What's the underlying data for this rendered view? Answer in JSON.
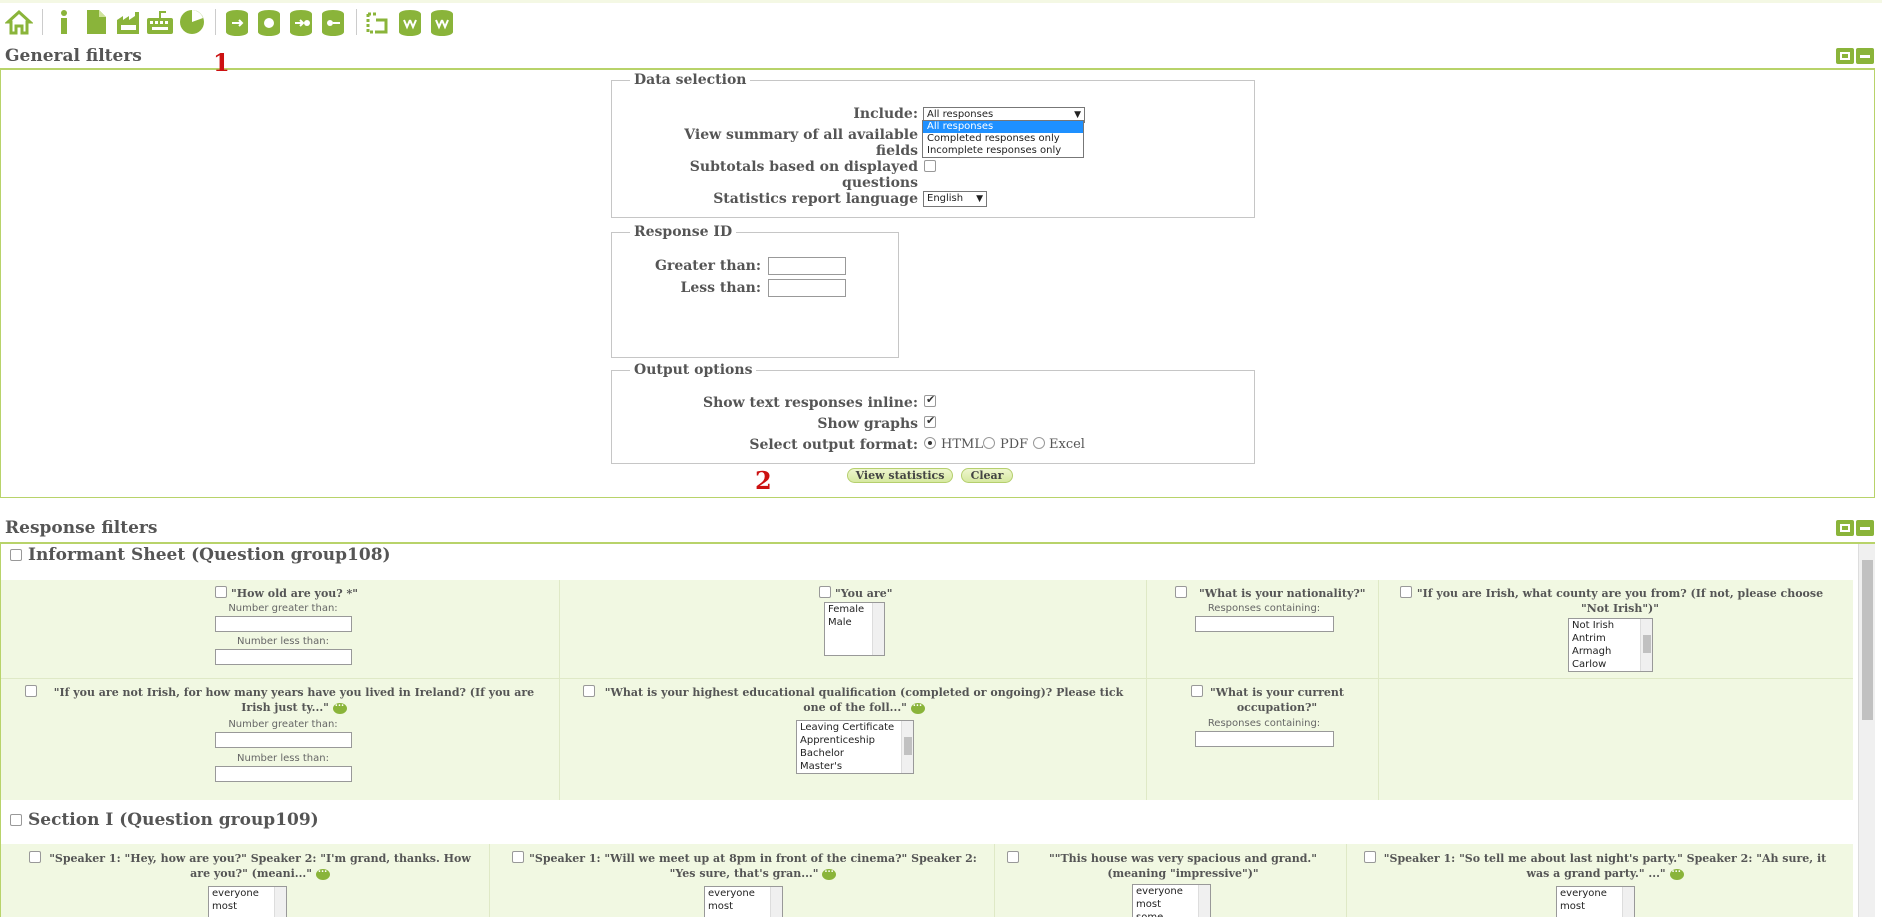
{
  "toolbar": {
    "icons": [
      "home-icon",
      "info-icon",
      "document-icon",
      "factory-icon",
      "keyboard-icon",
      "pie-chart-icon",
      "export-db-icon",
      "spss-db-icon",
      "export-r-db-icon",
      "export-r2-db-icon",
      "vv-import-icon",
      "vv-db-icon",
      "vv-export-icon"
    ],
    "accent": "#8ab43a"
  },
  "general": {
    "title": "General filters",
    "marker1": "1",
    "marker2": "2",
    "data_selection": {
      "legend": "Data selection",
      "include_label": "Include:",
      "include_value": "All responses",
      "include_options": [
        "All responses",
        "Completed responses only",
        "Incomplete responses only"
      ],
      "summary_label_1": "View summary of all available",
      "summary_label_2": "fields",
      "subtotals_label_1": "Subtotals based on displayed",
      "subtotals_label_2": "questions",
      "language_label": "Statistics report language",
      "language_value": "English"
    },
    "response_id": {
      "legend": "Response ID",
      "greater_label": "Greater than:",
      "less_label": "Less than:"
    },
    "output": {
      "legend": "Output options",
      "inline_label": "Show text responses inline:",
      "graphs_label": "Show graphs",
      "format_label": "Select output format:",
      "formats": [
        "HTML",
        "PDF",
        "Excel"
      ]
    },
    "view_button": "View statistics",
    "clear_button": "Clear"
  },
  "response": {
    "title": "Response filters",
    "group1": {
      "title": "Informant Sheet (Question group108)",
      "q1": "\"How old are you? *\"",
      "q2": "\"You are\"",
      "q2_options": [
        "Female",
        "Male"
      ],
      "q3": "\"What is your nationality?\"",
      "q4": "\"If you are Irish, what county are you from? (If not, please choose \"Not Irish\")\"",
      "q4_options": [
        "Not Irish",
        "Antrim",
        "Armagh",
        "Carlow"
      ],
      "q5": "\"If you are not Irish, for how many years have you lived in Ireland?   (If you are Irish just ty...\"",
      "q6": "\"What is your highest educational qualification (completed or ongoing)? Please tick one of the foll...\"",
      "q6_options": [
        "Leaving Certificate",
        "Apprenticeship",
        "Bachelor",
        "Master's"
      ],
      "q7": "\"What is your current occupation?\"",
      "num_greater": "Number greater than:",
      "num_less": "Number less than:",
      "resp_containing": "Responses containing:"
    },
    "group2": {
      "title": "Section I (Question group109)",
      "q1": "\"Speaker 1: \"Hey, how are you?\"   Speaker 2: \"I'm grand, thanks. How are you?\"       (meani...\"",
      "q2": "\"Speaker 1: \"Will we meet up at 8pm in front of the cinema?\"   Speaker 2: \"Yes sure, that's gran...\"",
      "q3": "\"\"This house was very spacious and grand.\"   (meaning \"impressive\")\"",
      "q4": "\"Speaker 1: \"So tell me about last night's party.\" Speaker 2: \"Ah sure, it was a grand party.\"   ...\"",
      "options": [
        "everyone",
        "most",
        "some"
      ]
    }
  }
}
